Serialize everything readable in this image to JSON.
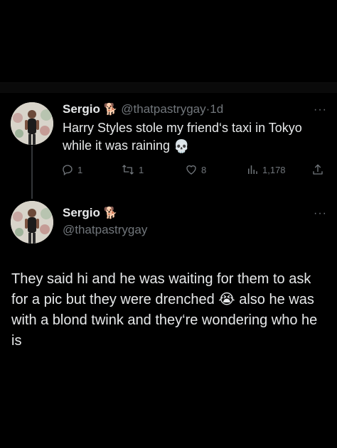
{
  "tweets": [
    {
      "display_name": "Sergio",
      "name_emoji": "🐕",
      "handle": "@thatpastrygay",
      "separator": "·",
      "time": "1d",
      "more": "···",
      "text": "Harry Styles stole my friend‘s taxi in Tokyo while it was raining",
      "text_emoji": "💀",
      "actions": {
        "replies": "1",
        "reposts": "1",
        "likes": "8",
        "views": "1,178"
      }
    },
    {
      "display_name": "Sergio",
      "name_emoji": "🐕",
      "handle": "@thatpastrygay",
      "more": "···",
      "text_part1": "They said hi and he was waiting for them to ask for a pic but they were drenched",
      "text_emoji": "😭",
      "text_part2": "also he was with a blond twink and they‘re wondering who he is"
    }
  ],
  "icons": {
    "reply": "reply-icon",
    "repost": "repost-icon",
    "like": "like-icon",
    "views": "views-icon",
    "share": "share-icon"
  },
  "colors": {
    "background": "#000000",
    "text": "#e7e9ea",
    "muted": "#71767b",
    "thread_line": "#333639"
  }
}
